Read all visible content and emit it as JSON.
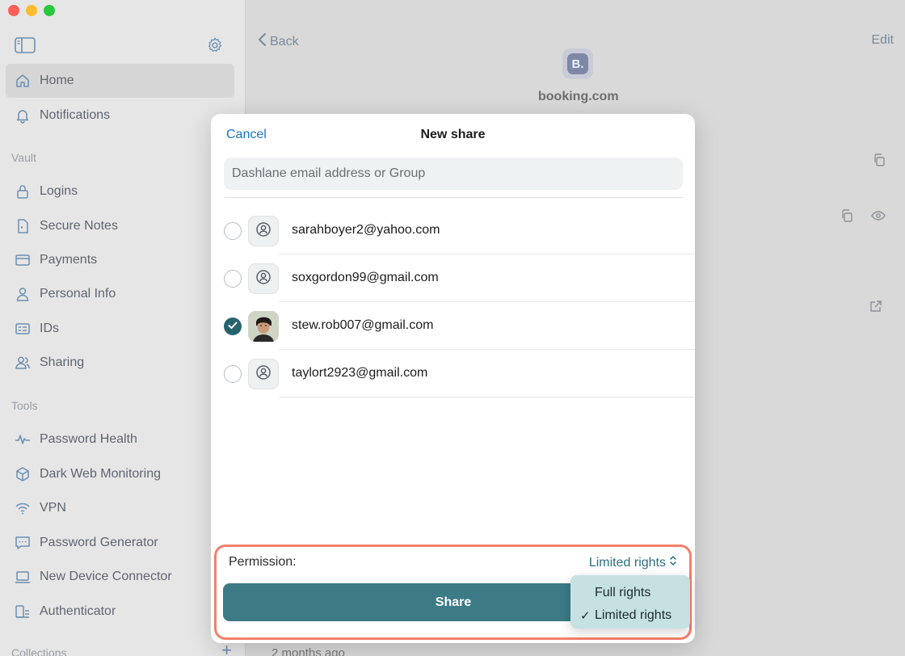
{
  "sidebar": {
    "items": [
      {
        "label": "Home",
        "icon": "home-icon"
      },
      {
        "label": "Notifications",
        "icon": "bell-icon"
      },
      {
        "label": "Logins",
        "icon": "lock-icon"
      },
      {
        "label": "Secure Notes",
        "icon": "note-icon"
      },
      {
        "label": "Payments",
        "icon": "card-icon"
      },
      {
        "label": "Personal Info",
        "icon": "person-icon"
      },
      {
        "label": "IDs",
        "icon": "id-icon"
      },
      {
        "label": "Sharing",
        "icon": "sharing-icon"
      },
      {
        "label": "Password Health",
        "icon": "pulse-icon"
      },
      {
        "label": "Dark Web Monitoring",
        "icon": "cube-icon"
      },
      {
        "label": "VPN",
        "icon": "wifi-icon"
      },
      {
        "label": "Password Generator",
        "icon": "generator-icon"
      },
      {
        "label": "New Device Connector",
        "icon": "laptop-icon"
      },
      {
        "label": "Authenticator",
        "icon": "authenticator-icon"
      }
    ],
    "sections": {
      "vault": "Vault",
      "tools": "Tools",
      "collections": "Collections"
    }
  },
  "main": {
    "back_label": "Back",
    "edit_label": "Edit",
    "site_logo_letter": "B.",
    "site_name": "booking.com",
    "timestamp": "2 months ago"
  },
  "modal": {
    "cancel_label": "Cancel",
    "title": "New share",
    "search_placeholder": "Dashlane email address or Group",
    "contacts": [
      {
        "email": "sarahboyer2@yahoo.com",
        "selected": false,
        "avatar": "generic"
      },
      {
        "email": "soxgordon99@gmail.com",
        "selected": false,
        "avatar": "generic"
      },
      {
        "email": "stew.rob007@gmail.com",
        "selected": true,
        "avatar": "photo"
      },
      {
        "email": "taylort2923@gmail.com",
        "selected": false,
        "avatar": "generic"
      }
    ],
    "permission_label": "Permission:",
    "permission_value": "Limited rights",
    "share_label": "Share",
    "dropdown_options": [
      {
        "label": "Full rights",
        "checked": false
      },
      {
        "label": "Limited rights",
        "checked": true
      }
    ]
  },
  "colors": {
    "accent": "#3c7a86",
    "link": "#1a73c9",
    "highlight_border": "#f2806a",
    "dropdown_bg": "#c6e1e2"
  }
}
